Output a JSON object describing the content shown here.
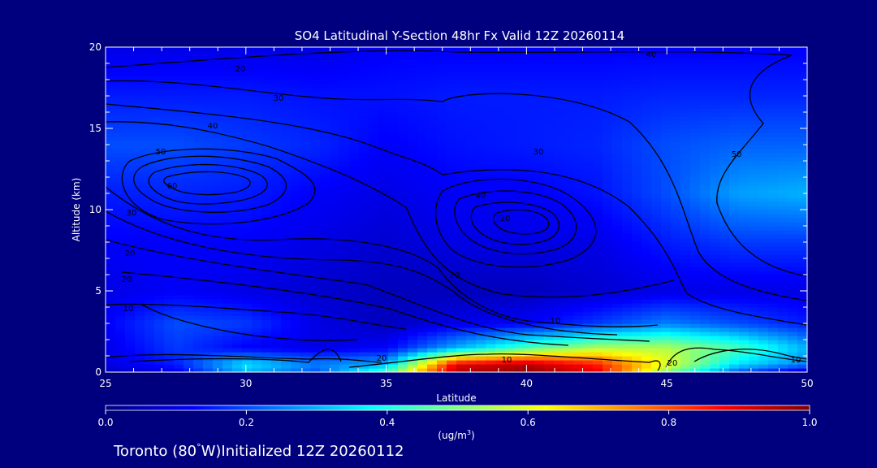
{
  "colors": {
    "background": "#00007f",
    "text": "#ffffff",
    "contour": "#000000",
    "colormap": [
      "#00007f",
      "#0000ff",
      "#0080ff",
      "#00ffff",
      "#80ff80",
      "#ffff00",
      "#ff8000",
      "#ff0000",
      "#7f0000"
    ]
  },
  "chart_data": {
    "type": "heatmap",
    "title": "SO4 Latitudinal Y-Section 48hr  Fx Valid 12Z 20260114",
    "xlabel": "Latitude",
    "ylabel": "Altitude (km)",
    "xlim": [
      25,
      50
    ],
    "ylim": [
      0,
      20
    ],
    "x_ticks": [
      25,
      30,
      35,
      40,
      45,
      50
    ],
    "y_ticks": [
      0,
      5,
      10,
      15,
      20
    ],
    "colorbar": {
      "label_prefix": "(ug/m",
      "label_exp": "3",
      "label_suffix": ")",
      "range": [
        0.0,
        1.0
      ],
      "ticks": [
        "0.0",
        "0.2",
        "0.4",
        "0.6",
        "0.8",
        "1.0"
      ]
    },
    "overlay": "contour",
    "contour_labels": [
      "20",
      "30",
      "40",
      "50",
      "60",
      "30",
      "20",
      "10",
      "40",
      "10",
      "10",
      "20",
      "20",
      "30",
      "40",
      "50",
      "20",
      "10",
      "20",
      "20"
    ],
    "field_lat": [
      25,
      27.5,
      30,
      32.5,
      35,
      37.5,
      40,
      42.5,
      45,
      47.5,
      50
    ],
    "field_alt": [
      0,
      0.5,
      1.5,
      3,
      5,
      8,
      11,
      14,
      17,
      20
    ],
    "field_values": [
      [
        0.05,
        0.1,
        0.3,
        0.2,
        0.45,
        0.95,
        0.98,
        0.9,
        0.5,
        0.2,
        0.05
      ],
      [
        0.1,
        0.15,
        0.35,
        0.25,
        0.3,
        0.9,
        0.95,
        0.85,
        0.6,
        0.35,
        0.25
      ],
      [
        0.1,
        0.18,
        0.12,
        0.1,
        0.12,
        0.3,
        0.45,
        0.55,
        0.55,
        0.45,
        0.3
      ],
      [
        0.12,
        0.2,
        0.18,
        0.1,
        0.06,
        0.1,
        0.12,
        0.18,
        0.25,
        0.2,
        0.15
      ],
      [
        0.1,
        0.12,
        0.1,
        0.08,
        0.06,
        0.06,
        0.06,
        0.08,
        0.1,
        0.1,
        0.1
      ],
      [
        0.12,
        0.12,
        0.12,
        0.1,
        0.08,
        0.1,
        0.1,
        0.1,
        0.15,
        0.18,
        0.18
      ],
      [
        0.15,
        0.16,
        0.15,
        0.12,
        0.1,
        0.12,
        0.12,
        0.14,
        0.2,
        0.28,
        0.3
      ],
      [
        0.2,
        0.2,
        0.18,
        0.16,
        0.12,
        0.14,
        0.15,
        0.16,
        0.2,
        0.22,
        0.22
      ],
      [
        0.15,
        0.15,
        0.15,
        0.14,
        0.14,
        0.15,
        0.15,
        0.15,
        0.16,
        0.16,
        0.16
      ],
      [
        0.1,
        0.1,
        0.1,
        0.1,
        0.12,
        0.12,
        0.12,
        0.12,
        0.12,
        0.12,
        0.12
      ]
    ]
  },
  "footer": {
    "prefix": "Toronto (80",
    "degree": "°",
    "suffix": "W)Initialized 12Z 20260112"
  }
}
